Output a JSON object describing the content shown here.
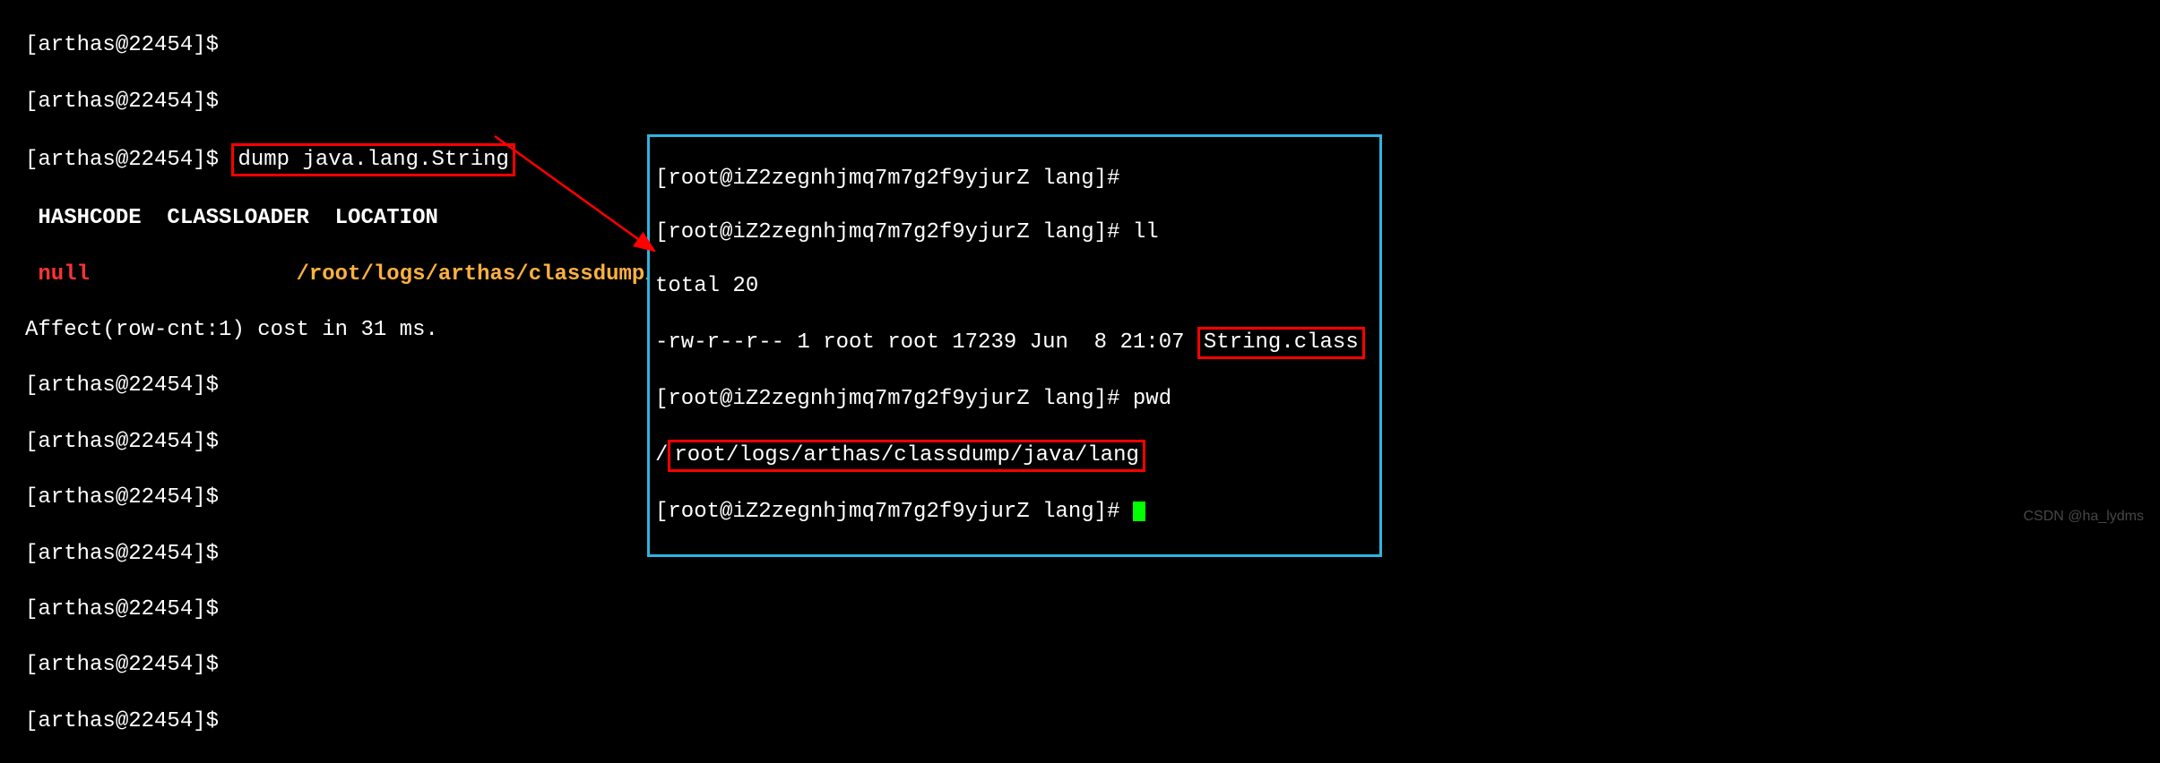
{
  "left": {
    "line0": "[arthas@22454]$ ",
    "prompt1": "[arthas@22454]$",
    "prompt2": "[arthas@22454]$",
    "cmd_dump": "dump java.lang.String",
    "header": " HASHCODE  CLASSLOADER  LOCATION",
    "null": " null",
    "location": "/root/logs/arthas/classdump/java/lang/String.class",
    "affect": "Affect(row-cnt:1) cost in 31 ms.",
    "p3": "[arthas@22454]$",
    "p4": "[arthas@22454]$",
    "p5": "[arthas@22454]$",
    "p6": "[arthas@22454]$",
    "p7": "[arthas@22454]$",
    "p8": "[arthas@22454]$",
    "p9": "[arthas@22454]$"
  },
  "right": {
    "l0": "[root@iZ2zegnhjmq7m7g2f9yjurZ lang]#",
    "l1_a": "[root@iZ2zegnhjmq7m7g2f9yjurZ lang]# ",
    "l1_b": "ll",
    "l2": "total 20",
    "l3_a": "-rw-r--r-- 1 root root 17239 Jun  8 21:07 ",
    "l3_b": "String.class",
    "l4_a": "[root@iZ2zegnhjmq7m7g2f9yjurZ lang]# ",
    "l4_b": "pwd",
    "l5_a": "/",
    "l5_b": "root/logs/arthas/classdump/java/lang",
    "l6": "[root@iZ2zegnhjmq7m7g2f9yjurZ lang]# "
  },
  "watermark": "CSDN @ha_lydms"
}
